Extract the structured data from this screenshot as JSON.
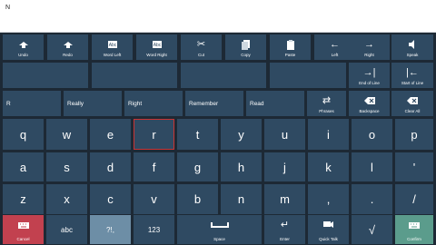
{
  "text_area": {
    "content": "N"
  },
  "commands": [
    {
      "label": "Undo",
      "icon": "undo-icon"
    },
    {
      "label": "Redo",
      "icon": "redo-icon"
    },
    {
      "label": "Word Left",
      "icon": "word-left-icon"
    },
    {
      "label": "Word Right",
      "icon": "word-right-icon"
    },
    {
      "label": "Cut",
      "icon": "scissors-icon"
    },
    {
      "label": "Copy",
      "icon": "copy-icon"
    },
    {
      "label": "Paste",
      "icon": "paste-icon"
    },
    {
      "label": "Left",
      "icon": "arrow-left-icon"
    },
    {
      "label": "Right",
      "icon": "arrow-right-icon"
    },
    {
      "label": "Speak",
      "icon": "speak-icon"
    }
  ],
  "line_keys": [
    {
      "label": "End of Line",
      "icon": "end-of-line-icon"
    },
    {
      "label": "Start of Line",
      "icon": "start-of-line-icon"
    }
  ],
  "predictions": [
    "R",
    "Really",
    "Right",
    "Remember",
    "Read"
  ],
  "right_keys": [
    {
      "label": "Phrases",
      "icon": "phrases-icon"
    },
    {
      "label": "Backspace",
      "icon": "backspace-icon"
    },
    {
      "label": "Clear All",
      "icon": "clear-all-icon"
    }
  ],
  "rows": {
    "row1": [
      "q",
      "w",
      "e",
      "r",
      "t",
      "y",
      "u",
      "i",
      "o",
      "p"
    ],
    "row2": [
      "a",
      "s",
      "d",
      "f",
      "g",
      "h",
      "j",
      "k",
      "l",
      "'"
    ],
    "row3": [
      "z",
      "x",
      "c",
      "v",
      "b",
      "n",
      "m",
      ",",
      ".",
      "/"
    ]
  },
  "selected_key": "r",
  "bottom": {
    "cancel": "Cancel",
    "abc": "abc",
    "symbols": "?!,",
    "numbers": "123",
    "space": "Space",
    "enter": "Enter",
    "quick_talk": "Quick Talk",
    "check": "√",
    "confirm": "Confirm"
  },
  "colors": {
    "background": "#1d2935",
    "key": "#2f4a62",
    "cancel": "#c2414f",
    "confirm": "#5b9c8c",
    "symbols": "#6d8ea6",
    "selected_border": "#c93434"
  }
}
